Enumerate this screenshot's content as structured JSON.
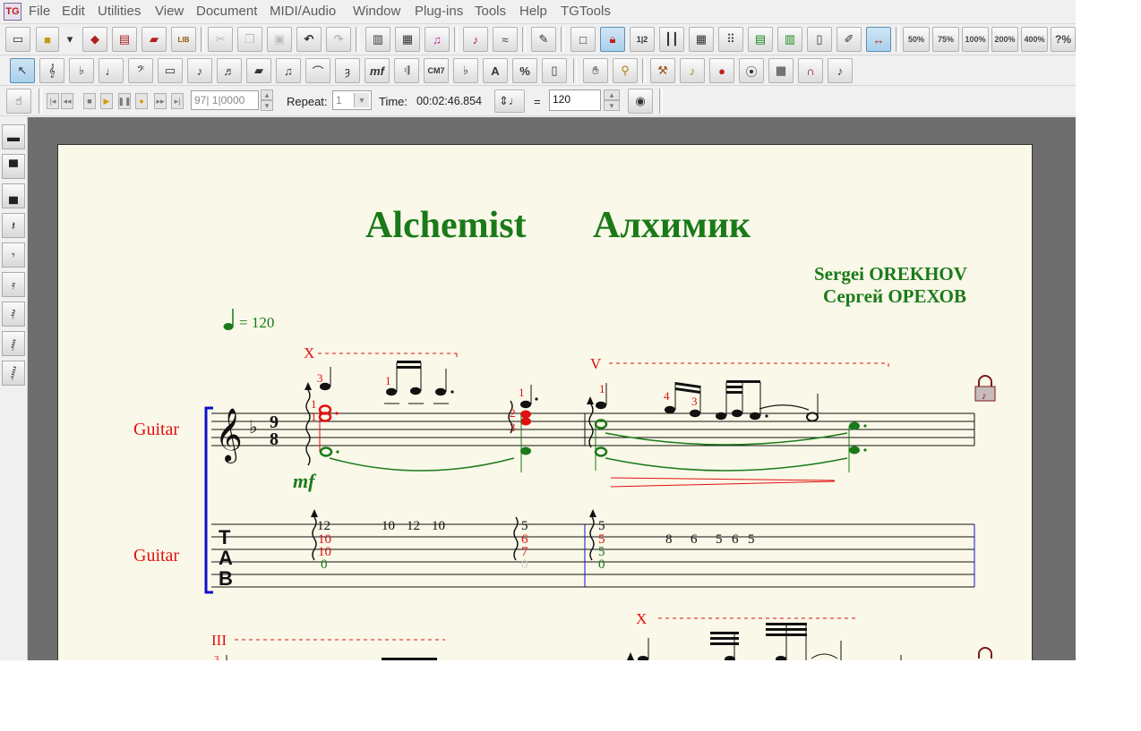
{
  "app": {
    "icon_text": "TG"
  },
  "menu": [
    "File",
    "Edit",
    "Utilities",
    "View",
    "Document",
    "MIDI/Audio",
    "Window",
    "Plug-ins",
    "Tools",
    "Help",
    "TGTools"
  ],
  "toolbar": {
    "zoom_labels": [
      "50%",
      "75%",
      "100%",
      "200%",
      "400%",
      "?%"
    ]
  },
  "playback": {
    "position": "97| 1|0000",
    "repeat_label": "Repeat:",
    "repeat_value": "1",
    "time_label": "Time:",
    "time_value": "00:02:46.854",
    "equals": "=",
    "tempo_value": "120"
  },
  "score": {
    "title_en": "Alchemist",
    "title_ru": "Алхимик",
    "composer_en": "Sergei OREKHOV",
    "composer_ru": "Сергей ОРЕХОВ",
    "tempo_mark": "= 120",
    "instrument_staff": "Guitar",
    "instrument_tab": "Guitar",
    "dynamic": "mf",
    "positions": {
      "m1": "X",
      "m2": "V",
      "sys2_a": "III",
      "sys2_b": "X"
    },
    "fingering": {
      "a": "3",
      "b": "1",
      "c": "1",
      "d": "1",
      "e": "1",
      "f": "1",
      "g": "2",
      "h": "3",
      "i": "1",
      "j": "4",
      "k": "3",
      "l": "3"
    },
    "tab": {
      "chord1": [
        "12",
        "10",
        "10",
        "0"
      ],
      "run1": [
        "10",
        "12",
        "10"
      ],
      "chord2": [
        "5",
        "6",
        "7",
        "0"
      ],
      "chord3": [
        "5",
        "5",
        "5",
        "0"
      ],
      "run2": [
        "8",
        "6",
        "5",
        "6",
        "5"
      ]
    },
    "clef_tab": [
      "T",
      "A",
      "B"
    ],
    "time_signature": [
      "9",
      "8"
    ],
    "colors": {
      "green": "#1a7a1a",
      "red": "#e01010",
      "blue": "#1010c8"
    }
  }
}
